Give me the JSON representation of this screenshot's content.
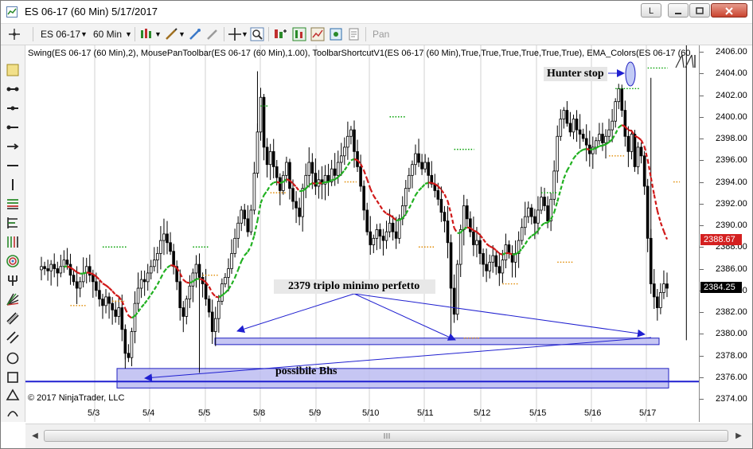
{
  "window": {
    "title": "ES 06-17 (60 Min)  5/17/2017",
    "buttons": {
      "lang": "L",
      "minimize": "▬",
      "maximize": "□",
      "close": "✕"
    }
  },
  "toolbar": {
    "instrument": "ES 06-17",
    "interval": "60 Min",
    "pan_label": "Pan"
  },
  "indicators_text": "Swing(ES 06-17 (60 Min),2), MousePanToolbar(ES 06-17 (60 Min),1.00), ToolbarShortcutV1(ES 06-17 (60 Min),True,True,True,True,True,True), EMA_Colors(ES 06-17 (60",
  "copyright": "© 2017 NinjaTrader, LLC",
  "annotations": {
    "hunter_stop": "Hunter stop",
    "triple_min": "2379 triplo minimo perfetto",
    "possible_bhs": "possibile Bhs"
  },
  "price_axis": {
    "labels": [
      "2406.00",
      "2404.00",
      "2402.00",
      "2400.00",
      "2398.00",
      "2396.00",
      "2394.00",
      "2392.00",
      "2390.00",
      "2388.00",
      "2386.00",
      "2384.00",
      "2382.00",
      "2380.00",
      "2378.00",
      "2376.00",
      "2374.00"
    ],
    "red_tag": "2388.67",
    "last_tag": "2384.25"
  },
  "time_axis": {
    "labels": [
      "5/3",
      "5/4",
      "5/5",
      "5/8",
      "5/9",
      "5/10",
      "5/11",
      "5/12",
      "5/15",
      "5/16",
      "5/17"
    ]
  },
  "chart_data": {
    "type": "candlestick",
    "ylim": [
      2373.5,
      2406.5
    ],
    "price_labels_values": [
      2406,
      2404,
      2402,
      2400,
      2398,
      2396,
      2394,
      2392,
      2390,
      2388,
      2386,
      2384,
      2382,
      2380,
      2378,
      2376,
      2374
    ],
    "date_labels": [
      "5/3",
      "5/4",
      "5/5",
      "5/8",
      "5/9",
      "5/10",
      "5/11",
      "5/12",
      "5/15",
      "5/16",
      "5/17"
    ],
    "support_zones": [
      {
        "from": 2379.0,
        "to": 2379.6,
        "label": "2379 triplo minimo perfetto"
      },
      {
        "from": 2375.0,
        "to": 2376.8,
        "label": "possibile Bhs"
      }
    ],
    "horizontal_line": 2375.6,
    "closes": [
      2386.2,
      2386.0,
      2385.8,
      2386.4,
      2386.0,
      2385.6,
      2386.2,
      2386.8,
      2386.4,
      2385.4,
      2384.8,
      2384.2,
      2384.8,
      2385.6,
      2386.2,
      2385.4,
      2384.8,
      2384.0,
      2383.2,
      2382.6,
      2383.4,
      2382.8,
      2382.2,
      2381.6,
      2382.4,
      2380.4,
      2378.2,
      2377.8,
      2380.2,
      2382.8,
      2384.2,
      2385.0,
      2384.8,
      2385.6,
      2386.2,
      2386.8,
      2387.4,
      2388.6,
      2389.2,
      2388.4,
      2387.6,
      2386.2,
      2384.8,
      2382.4,
      2381.6,
      2383.2,
      2384.4,
      2385.6,
      2386.4,
      2385.2,
      2384.6,
      2383.2,
      2382.0,
      2380.2,
      2381.4,
      2383.0,
      2384.6,
      2385.2,
      2386.0,
      2387.4,
      2388.8,
      2390.2,
      2391.4,
      2390.6,
      2389.4,
      2391.4,
      2394.8,
      2398.6,
      2401.8,
      2397.2,
      2395.6,
      2396.8,
      2395.4,
      2394.4,
      2393.2,
      2394.6,
      2395.8,
      2393.4,
      2392.2,
      2391.6,
      2390.8,
      2393.4,
      2394.6,
      2395.8,
      2394.8,
      2393.6,
      2394.2,
      2393.8,
      2394.6,
      2394.0,
      2395.2,
      2394.6,
      2395.8,
      2396.4,
      2397.2,
      2398.2,
      2398.8,
      2396.8,
      2395.4,
      2393.6,
      2391.4,
      2389.4,
      2388.2,
      2388.8,
      2389.6,
      2389.0,
      2388.6,
      2389.4,
      2390.2,
      2389.4,
      2388.8,
      2390.6,
      2391.8,
      2393.4,
      2394.6,
      2395.6,
      2396.6,
      2395.8,
      2395.2,
      2395.8,
      2394.6,
      2393.8,
      2393.2,
      2392.4,
      2391.2,
      2390.4,
      2388.4,
      2384.2,
      2381.8,
      2386.4,
      2389.6,
      2391.8,
      2390.6,
      2389.4,
      2388.2,
      2388.6,
      2387.4,
      2386.4,
      2385.8,
      2386.6,
      2387.2,
      2386.2,
      2385.6,
      2386.8,
      2388.2,
      2387.4,
      2386.6,
      2387.4,
      2388.6,
      2389.8,
      2390.8,
      2391.6,
      2390.8,
      2390.2,
      2391.4,
      2392.6,
      2391.8,
      2390.4,
      2392.4,
      2395.0,
      2398.2,
      2399.8,
      2400.6,
      2399.4,
      2398.6,
      2399.8,
      2398.8,
      2398.4,
      2398.0,
      2397.4,
      2396.6,
      2397.2,
      2397.8,
      2398.4,
      2397.6,
      2398.2,
      2398.8,
      2399.6,
      2401.4,
      2402.6,
      2400.6,
      2398.2,
      2396.8,
      2398.4,
      2395.4,
      2397.2,
      2396.4,
      2393.6,
      2388.8,
      2384.6,
      2383.4,
      2382.4,
      2383.8,
      2384.6,
      2384.2
    ]
  }
}
